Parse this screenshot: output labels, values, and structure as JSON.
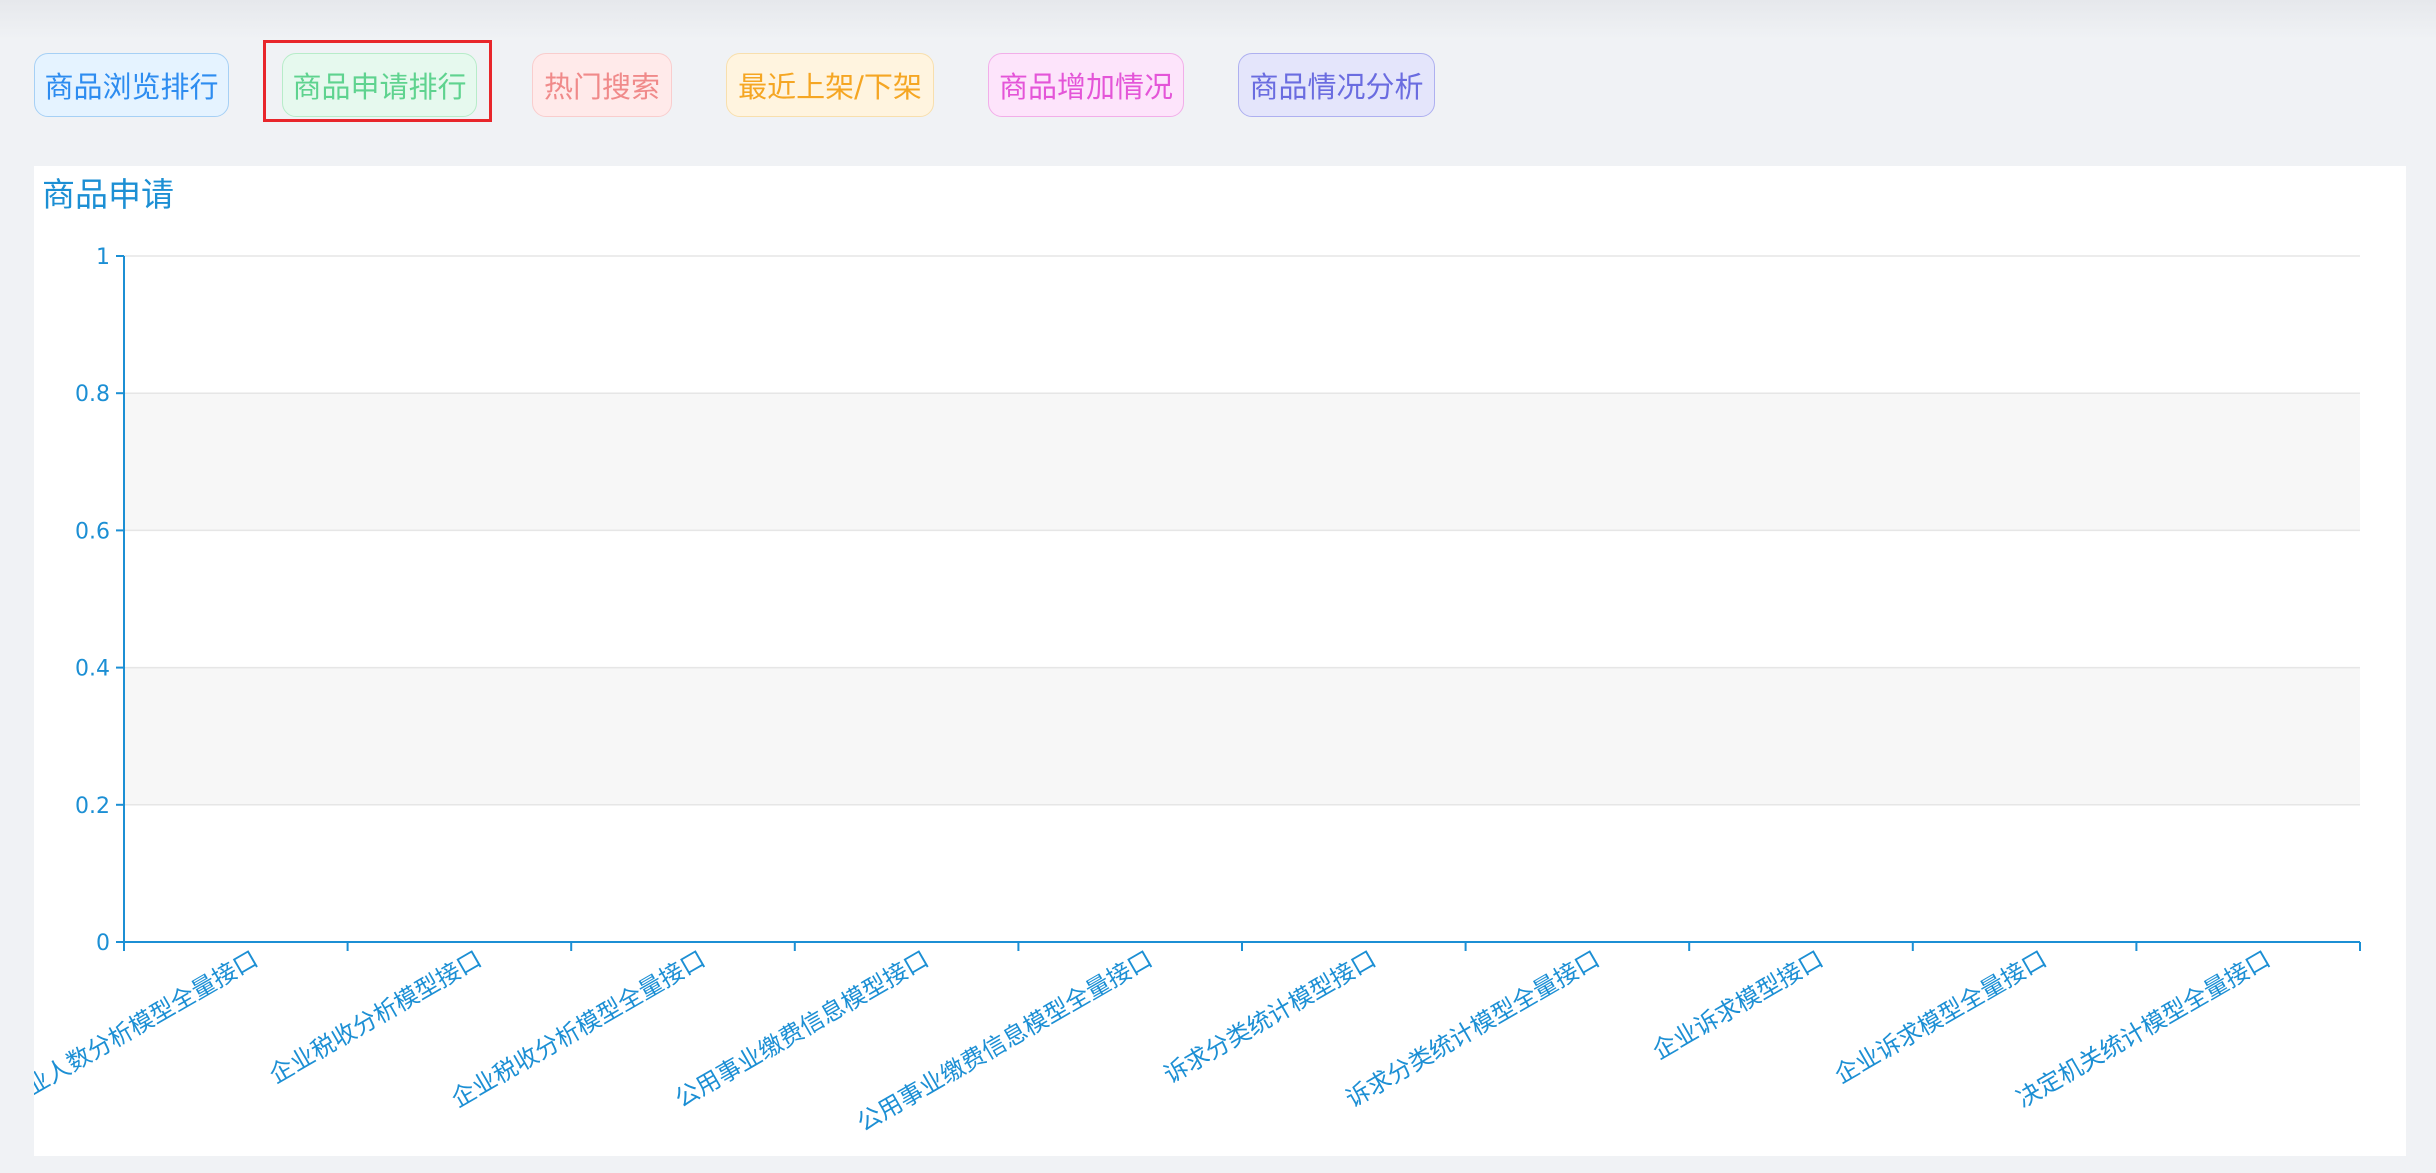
{
  "tabs": [
    {
      "label": "商品浏览排行",
      "color": "#2d8cf0",
      "bg": "#e5f3ff",
      "border": "#a6d0f5"
    },
    {
      "label": "商品申请排行",
      "color": "#5fd38f",
      "bg": "#e6f9ee",
      "border": "#b7ecc9"
    },
    {
      "label": "热门搜索",
      "color": "#f08a8a",
      "bg": "#ffeaea",
      "border": "#f9cdcd"
    },
    {
      "label": "最近上架/下架",
      "color": "#f5a623",
      "bg": "#fff4df",
      "border": "#f8dfad"
    },
    {
      "label": "商品增加情况",
      "color": "#e455d8",
      "bg": "#fde4fb",
      "border": "#f2aee9"
    },
    {
      "label": "商品情况分析",
      "color": "#6a6ce0",
      "bg": "#e4e5fb",
      "border": "#aeb0f0"
    }
  ],
  "selected_tab_index": 1,
  "panel": {
    "title": "商品申请"
  },
  "colors": {
    "axis": "#1c8fd4",
    "grid": "#e6e6e6",
    "band": "#f7f7f7"
  },
  "chart_data": {
    "type": "bar",
    "title": "商品申请",
    "categories": [
      "企业人数分析模型全量接口",
      "企业税收分析模型接口",
      "企业税收分析模型全量接口",
      "公用事业缴费信息模型接口",
      "公用事业缴费信息模型全量接口",
      "诉求分类统计模型接口",
      "诉求分类统计模型全量接口",
      "企业诉求模型接口",
      "企业诉求模型全量接口",
      "决定机关统计模型全量接口"
    ],
    "values": [
      0,
      0,
      0,
      0,
      0,
      0,
      0,
      0,
      0,
      0
    ],
    "ylim": [
      0,
      1
    ],
    "yticks": [
      "0",
      "0.2",
      "0.4",
      "0.6",
      "0.8",
      "1"
    ],
    "xlabel": "",
    "ylabel": "",
    "grid": true
  }
}
